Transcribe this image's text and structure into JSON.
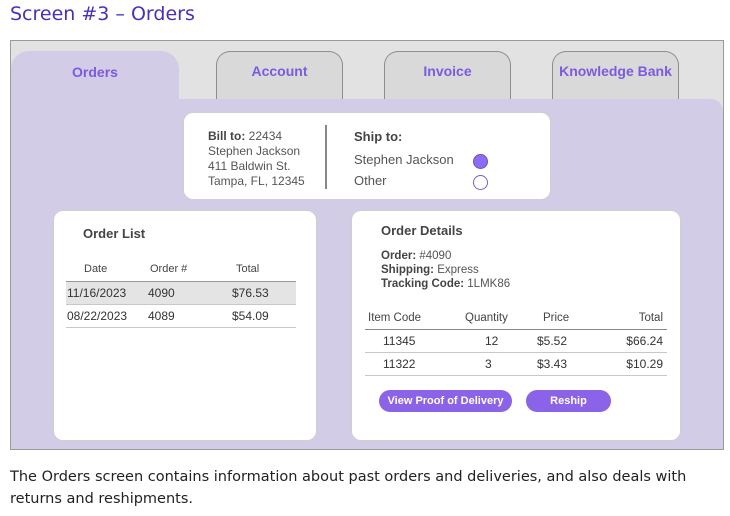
{
  "screen_title": "Screen #3 – Orders",
  "tabs": [
    {
      "label": "Orders",
      "active": true
    },
    {
      "label": "Account",
      "active": false
    },
    {
      "label": "Invoice",
      "active": false
    },
    {
      "label": "Knowledge Bank",
      "active": false
    }
  ],
  "bill_to": {
    "label": "Bill to:",
    "number": "22434",
    "name": "Stephen Jackson",
    "street": "411 Baldwin St.",
    "city": "Tampa, FL, 12345"
  },
  "ship_to": {
    "title": "Ship to:",
    "options": [
      {
        "label": "Stephen Jackson",
        "selected": true
      },
      {
        "label": "Other",
        "selected": false
      }
    ]
  },
  "order_list": {
    "title": "Order List",
    "headers": [
      "Date",
      "Order #",
      "Total"
    ],
    "rows": [
      {
        "date": "11/16/2023",
        "order": "4090",
        "total": "$76.53",
        "selected": true
      },
      {
        "date": "08/22/2023",
        "order": "4089",
        "total": "$54.09",
        "selected": false
      }
    ]
  },
  "order_details": {
    "title": "Order Details",
    "order_label": "Order:",
    "order_value": "#4090",
    "shipping_label": "Shipping:",
    "shipping_value": "Express",
    "tracking_label": "Tracking Code:",
    "tracking_value": "1LMK86",
    "headers": [
      "Item Code",
      "Quantity",
      "Price",
      "Total"
    ],
    "items": [
      {
        "code": "11345",
        "qty": "12",
        "price": "$5.52",
        "total": "$66.24"
      },
      {
        "code": "11322",
        "qty": "3",
        "price": "$3.43",
        "total": "$10.29"
      }
    ],
    "proof_button": "View Proof of Delivery",
    "reship_button": "Reship"
  },
  "caption": "The Orders screen contains information about past orders and deliveries, and also deals with returns and reshipments.",
  "colors": {
    "accent": "#8a63e8",
    "tab_text": "#7a5be0",
    "panel": "#d3cce7",
    "title": "#4a2fbf"
  }
}
